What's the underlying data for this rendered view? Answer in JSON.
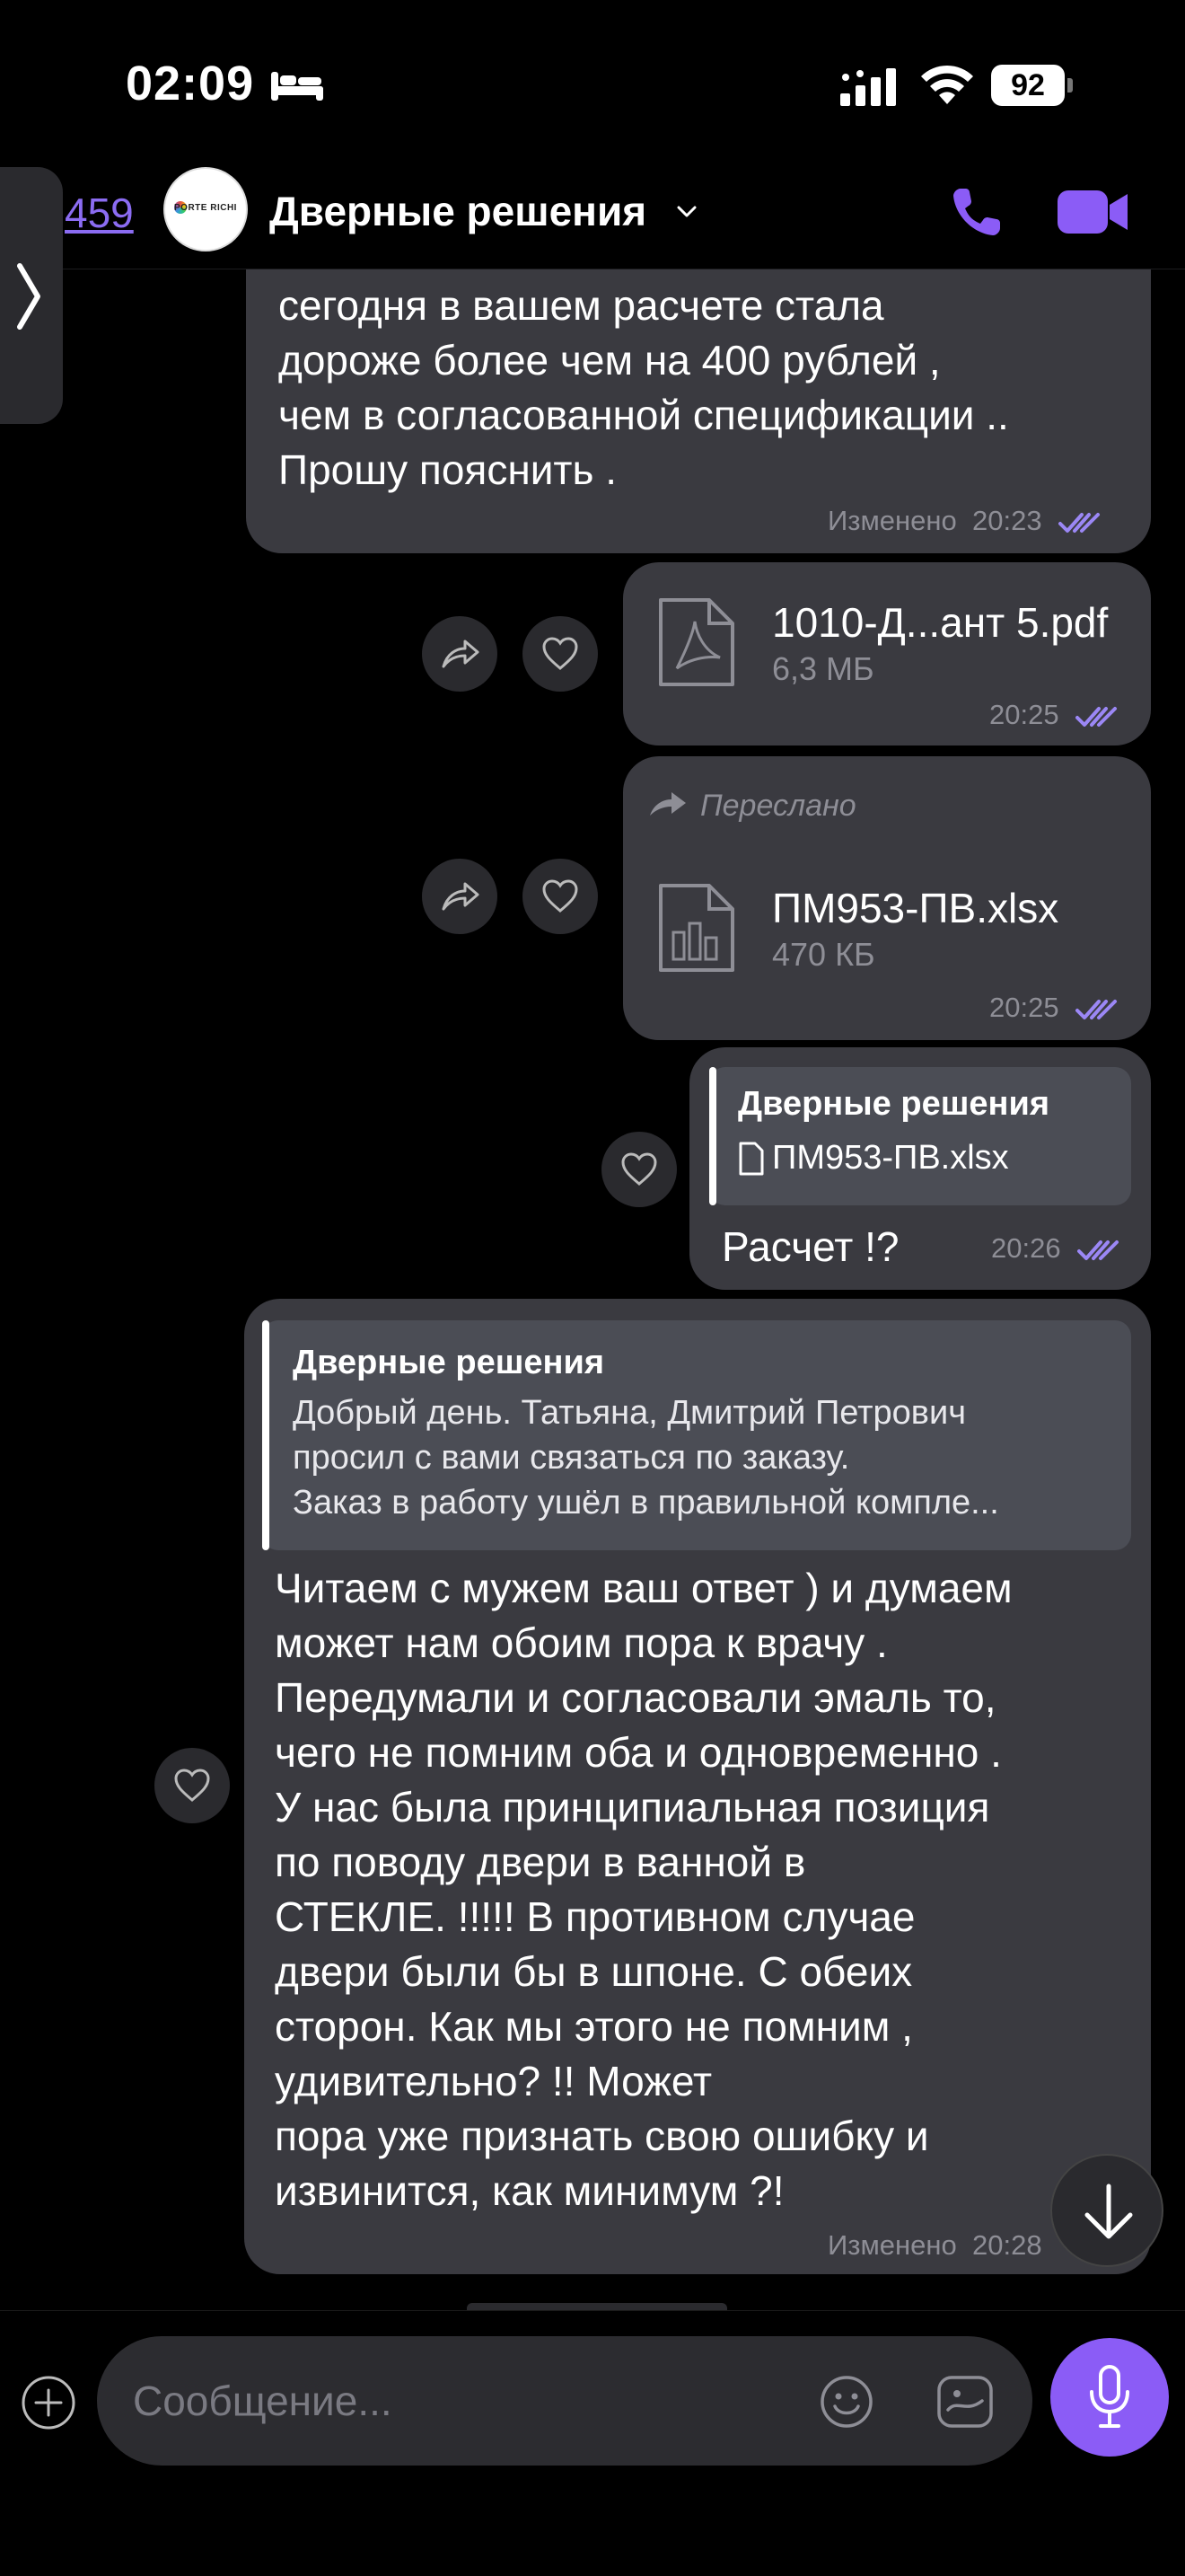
{
  "status_bar": {
    "time": "02:09",
    "battery": "92",
    "icons": [
      "bed-icon",
      "signal-icon",
      "wifi-icon",
      "battery-icon"
    ]
  },
  "header": {
    "back_count": "459",
    "avatar_text": "PORTE RICHI",
    "title": "Дверные решения",
    "icons": [
      "chevron-down-icon",
      "phone-icon",
      "video-camera-icon"
    ],
    "accent_color": "#8b6cf2"
  },
  "messages": [
    {
      "text": "сегодня в вашем  расчете стала\nдороже  более чем на 400 рублей ,\nчем в согласованной спецификации ..\nПрошу пояснить .",
      "edited_label": "Изменено",
      "time": "20:23"
    },
    {
      "file_name": "1010-Д...ант 5.pdf",
      "file_size": "6,3 МБ",
      "time": "20:25",
      "icon": "pdf-file-icon"
    },
    {
      "forwarded_label": "Переслано",
      "file_name": "ПМ953-ПВ.xlsx",
      "file_size": "470 КБ",
      "time": "20:25",
      "icon": "spreadsheet-file-icon"
    },
    {
      "reply_author": "Дверные решения",
      "reply_file": "ПМ953-ПВ.xlsx",
      "text": "Расчет !?",
      "time": "20:26"
    },
    {
      "reply_author": "Дверные решения",
      "reply_text": "Добрый день. Татьяна,  Дмитрий Петрович\nпросил с вами связаться по заказу.\nЗаказ в работу ушёл в правильной компле...",
      "text": "Читаем с мужем ваш ответ ) и думаем\nможет нам обоим пора к врачу .\nПередумали   и согласовали  эмаль то,\nчего не помним оба и одновременно .\nУ  нас была принципиальная позиция\nпо поводу двери в ванной в\nСТЕКЛЕ. !!!!!  В противном случае\nдвери были бы в шпоне. С обеих\nсторон.  Как мы этого не помним ,\nудивительно?  !!                          Может\nпора уже признать свою ошибку и\nизвинится, как минимум ?!",
      "edited_label": "Изменено",
      "time": "20:28"
    }
  ],
  "composer": {
    "placeholder": "Сообщение...",
    "icons": [
      "plus-icon",
      "emoji-icon",
      "sticker-icon",
      "microphone-icon"
    ]
  },
  "colors": {
    "bubble": "#3a3a40",
    "accent": "#8b5cf6",
    "ticks": "#9b87f5"
  }
}
